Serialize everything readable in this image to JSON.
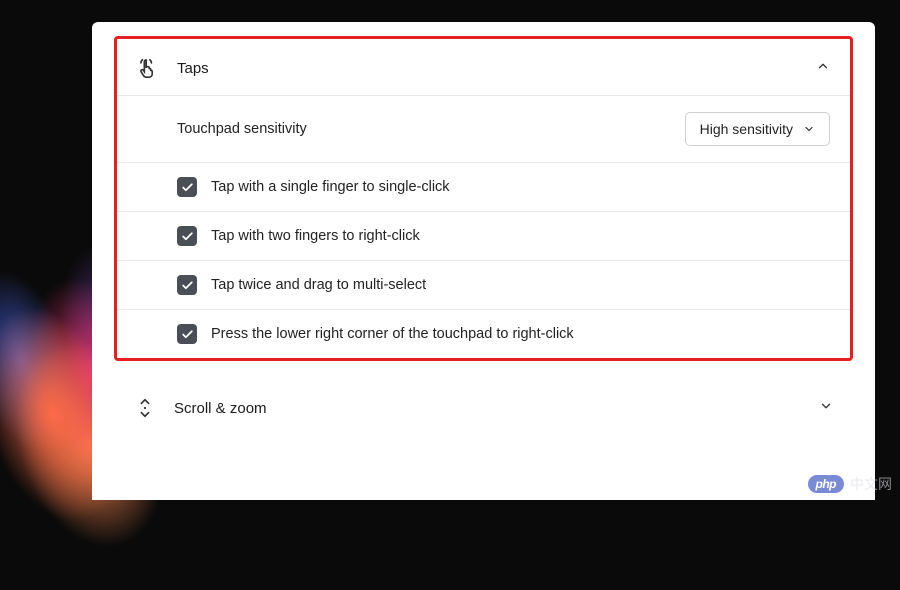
{
  "sections": {
    "taps": {
      "title": "Taps",
      "sensitivity": {
        "label": "Touchpad sensitivity",
        "value": "High sensitivity"
      },
      "options": [
        {
          "label": "Tap with a single finger to single-click",
          "checked": true
        },
        {
          "label": "Tap with two fingers to right-click",
          "checked": true
        },
        {
          "label": "Tap twice and drag to multi-select",
          "checked": true
        },
        {
          "label": "Press the lower right corner of the touchpad to right-click",
          "checked": true
        }
      ]
    },
    "scroll_zoom": {
      "title": "Scroll & zoom"
    }
  },
  "watermark": {
    "pill": "php",
    "text": "中文网"
  }
}
